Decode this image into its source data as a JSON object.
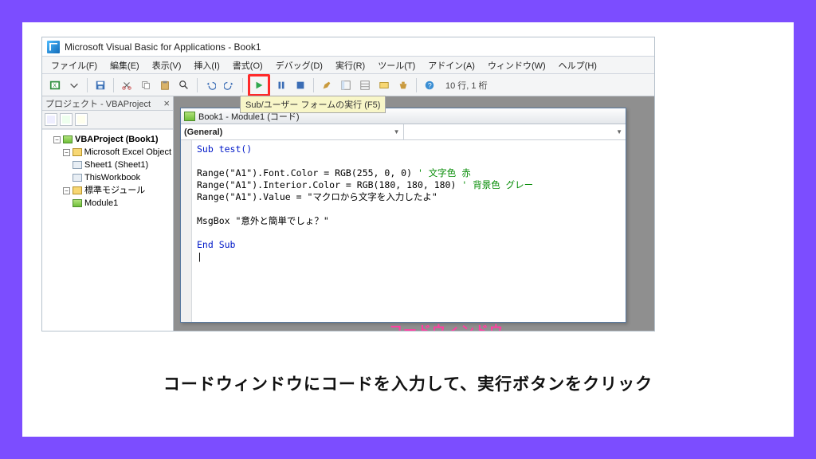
{
  "window_title": "Microsoft Visual Basic for Applications - Book1",
  "menus": [
    "ファイル(F)",
    "編集(E)",
    "表示(V)",
    "挿入(I)",
    "書式(O)",
    "デバッグ(D)",
    "実行(R)",
    "ツール(T)",
    "アドイン(A)",
    "ウィンドウ(W)",
    "ヘルプ(H)"
  ],
  "toolbar_status": "10 行, 1 桁",
  "run_tooltip": "Sub/ユーザー フォームの実行 (F5)",
  "project_explorer": {
    "title": "プロジェクト - VBAProject",
    "root": "VBAProject (Book1)",
    "excel_objects_folder": "Microsoft Excel Object",
    "sheet1": "Sheet1 (Sheet1)",
    "thiswb": "ThisWorkbook",
    "modules_folder": "標準モジュール",
    "module1": "Module1"
  },
  "code_window": {
    "title": "Book1 - Module1 (コード)",
    "combo_left": "(General)",
    "combo_right": "",
    "lines": {
      "l1": "Sub test()",
      "l2": "",
      "l3a": "Range(\"A1\").Font.Color = RGB(255, 0, 0) ",
      "l3c": "' 文字色 赤",
      "l4a": "Range(\"A1\").Interior.Color = RGB(180, 180, 180) ",
      "l4c": "' 背景色 グレー",
      "l5": "Range(\"A1\").Value = \"マクロから文字を入力したよ\"",
      "l6": "",
      "l7": "MsgBox \"意外と簡単でしょ？\"",
      "l8": "",
      "l9": "End Sub",
      "l10": "|"
    }
  },
  "annotation_codewindow": "コードウィンドウ",
  "caption": "コードウィンドウにコードを入力して、実行ボタンをクリック"
}
